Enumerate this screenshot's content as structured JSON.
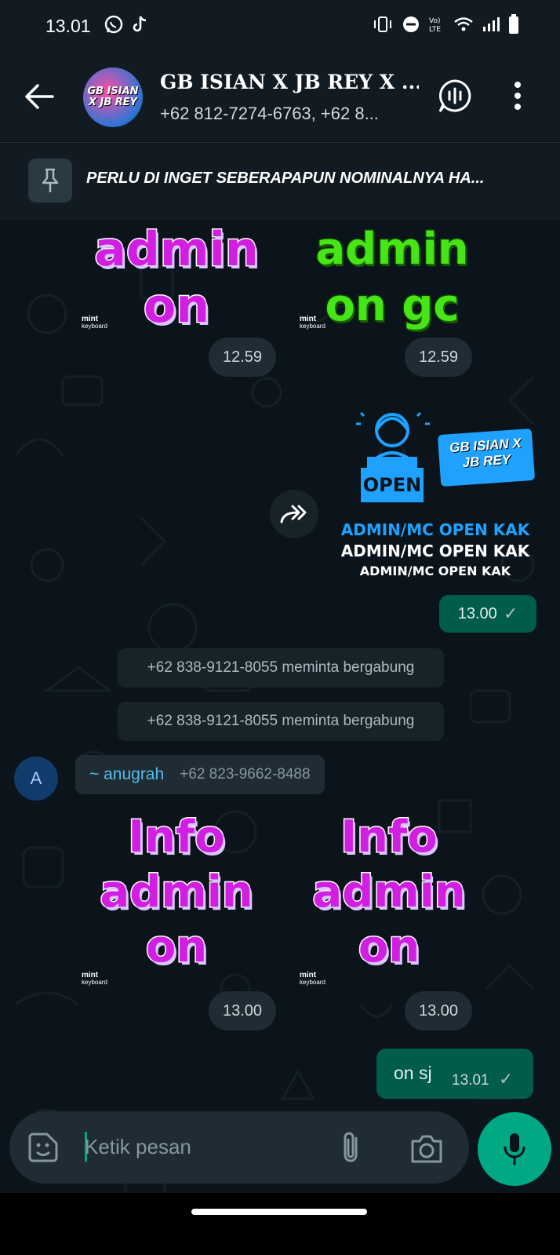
{
  "status_bar": {
    "time": "13.01"
  },
  "header": {
    "group_name": "GB ISIAN X JB REY X ...",
    "members": "+62 812-7274-6763, +62 8...",
    "avatar_text": "GB ISIAN X JB REY"
  },
  "pinned": {
    "text": "PERLU DI INGET SEBERAPAPUN NOMINALNYA HA..."
  },
  "stickers": {
    "first_left_line1": "admin",
    "first_left_line2": "on",
    "first_right_line1": "admin",
    "first_right_line2": "on gc",
    "watermark": "mint",
    "watermark_sub": "keyboard",
    "time_a": "12.59",
    "time_b": "12.59"
  },
  "forwarded": {
    "open_label": "OPEN",
    "badge_line1": "GB ISIAN X",
    "badge_line2": "JB REY",
    "line1": "ADMIN/MC OPEN KAK",
    "line2": "ADMIN/MC OPEN KAK",
    "line3": "ADMIN/MC OPEN KAK",
    "time": "13.00",
    "tick": "✓"
  },
  "system": [
    {
      "text": "+62 838-9121-8055 meminta bergabung"
    },
    {
      "text": "+62 838-9121-8055 meminta bergabung"
    }
  ],
  "incoming": {
    "avatar_letter": "A",
    "sender_name": "~ anugrah",
    "sender_phone": "+62 823-9662-8488",
    "sticker_line1": "Info",
    "sticker_line2": "admin",
    "sticker_line3": "on",
    "time_a": "13.00",
    "time_b": "13.00"
  },
  "outgoing_text": {
    "text": "on sj",
    "time": "13.01",
    "tick": "✓"
  },
  "composer": {
    "placeholder": "Ketik pesan"
  },
  "colors": {
    "accent": "#00a884",
    "outgoing_bubble": "#005c4b",
    "background": "#0b141a"
  }
}
